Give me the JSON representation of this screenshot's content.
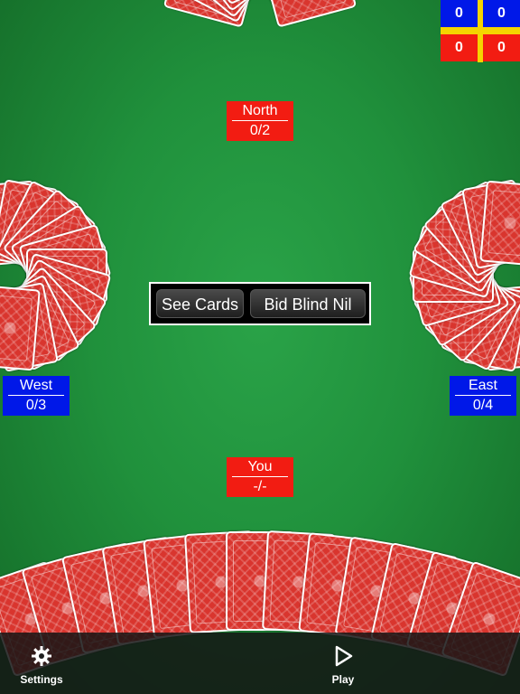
{
  "players": {
    "north": {
      "name": "North",
      "score": "0/2",
      "color": "#f21c12"
    },
    "west": {
      "name": "West",
      "score": "0/3",
      "color": "#0018e8"
    },
    "east": {
      "name": "East",
      "score": "0/4",
      "color": "#0018e8"
    },
    "you": {
      "name": "You",
      "score": "-/-",
      "color": "#f21c12"
    }
  },
  "scoreboard": {
    "blue_top_left": "0",
    "blue_top_right": "0",
    "red_bottom_left": "0",
    "red_bottom_right": "0",
    "team_colors": {
      "blue": "#0018e8",
      "red": "#f21c12",
      "divider": "#f5d400"
    }
  },
  "bid_panel": {
    "see_cards_label": "See Cards",
    "bid_blind_nil_label": "Bid Blind Nil"
  },
  "toolbar": {
    "settings_label": "Settings",
    "settings_icon": "gear-icon",
    "play_label": "Play",
    "play_icon": "play-icon"
  },
  "colors": {
    "table_felt": "#20913c",
    "card_back": "#d9352e"
  }
}
